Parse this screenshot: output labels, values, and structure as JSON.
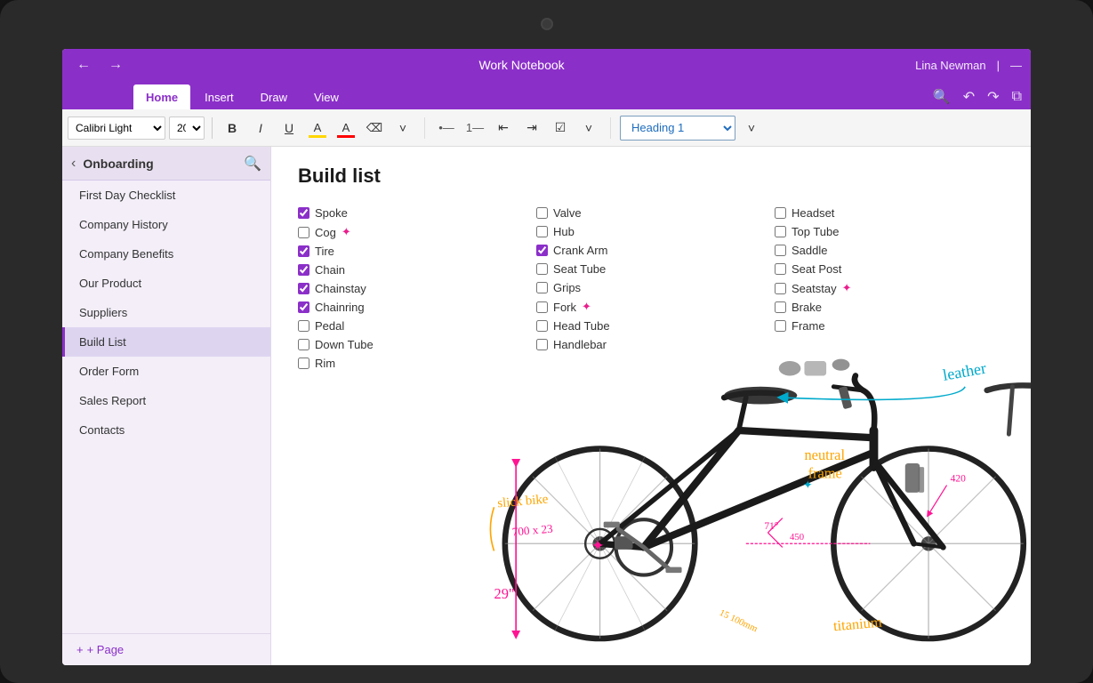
{
  "app": {
    "title": "Work Notebook",
    "user": "Lina Newman"
  },
  "ribbon": {
    "tabs": [
      "Home",
      "Insert",
      "Draw",
      "View"
    ],
    "active_tab": "Home"
  },
  "toolbar": {
    "font": "Calibri Light",
    "font_size": "20",
    "heading": "Heading 1"
  },
  "sidebar": {
    "title": "Onboarding",
    "items": [
      {
        "label": "First Day Checklist",
        "active": false
      },
      {
        "label": "Company History",
        "active": false
      },
      {
        "label": "Company Benefits",
        "active": false
      },
      {
        "label": "Our Product",
        "active": false
      },
      {
        "label": "Suppliers",
        "active": false
      },
      {
        "label": "Build List",
        "active": true
      },
      {
        "label": "Order Form",
        "active": false
      },
      {
        "label": "Sales Report",
        "active": false
      },
      {
        "label": "Contacts",
        "active": false
      }
    ],
    "add_page": "+ Page"
  },
  "page": {
    "title": "Build list"
  },
  "checklist": {
    "columns": [
      [
        {
          "label": "Spoke",
          "checked": true
        },
        {
          "label": "Cog",
          "checked": false,
          "star": true
        },
        {
          "label": "Tire",
          "checked": true
        },
        {
          "label": "Chain",
          "checked": true
        },
        {
          "label": "Chainstay",
          "checked": true
        },
        {
          "label": "Chainring",
          "checked": true
        },
        {
          "label": "Pedal",
          "checked": false
        },
        {
          "label": "Down Tube",
          "checked": false
        },
        {
          "label": "Rim",
          "checked": false
        }
      ],
      [
        {
          "label": "Valve",
          "checked": false
        },
        {
          "label": "Hub",
          "checked": false
        },
        {
          "label": "Crank Arm",
          "checked": true
        },
        {
          "label": "Seat Tube",
          "checked": false
        },
        {
          "label": "Grips",
          "checked": false
        },
        {
          "label": "Fork",
          "checked": false,
          "star": true
        },
        {
          "label": "Head Tube",
          "checked": false
        },
        {
          "label": "Handlebar",
          "checked": false
        }
      ],
      [
        {
          "label": "Headset",
          "checked": false
        },
        {
          "label": "Top Tube",
          "checked": false
        },
        {
          "label": "Saddle",
          "checked": false
        },
        {
          "label": "Seat Post",
          "checked": false
        },
        {
          "label": "Seatstay",
          "checked": false,
          "star": true
        },
        {
          "label": "Brake",
          "checked": false
        },
        {
          "label": "Frame",
          "checked": false
        }
      ]
    ]
  },
  "annotations": {
    "leather": "leather",
    "neutral_frame": "neutral\nframe",
    "slick_bike": "slick bike",
    "size_700": "700 x 23",
    "size_29": "29\"",
    "titanium": "titanium",
    "angle_71": "71°",
    "dim_450": "450",
    "dim_420": "420",
    "dim_100": "15 100mm"
  }
}
